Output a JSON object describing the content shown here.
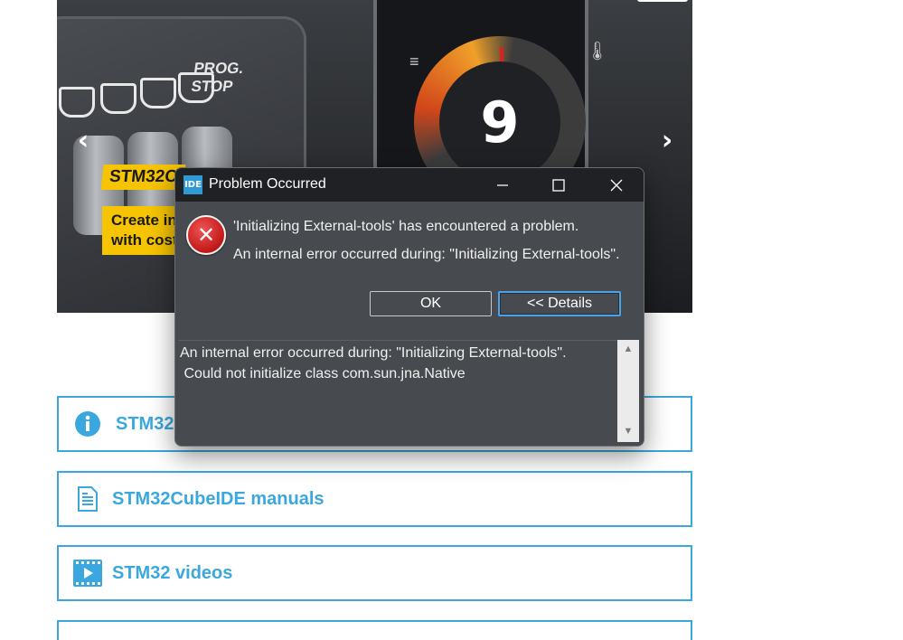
{
  "carousel": {
    "tag_text": "STM32C",
    "tag_text2": "Create in\nwith cost",
    "panel_label": "PROG.\nSTOP",
    "gauge_value": "9",
    "prev_arrow": "‹",
    "next_arrow": "›"
  },
  "cards": [
    {
      "label": "STM32",
      "icon": "info-icon"
    },
    {
      "label": "STM32CubeIDE manuals",
      "icon": "document-icon"
    },
    {
      "label": "STM32 videos",
      "icon": "video-icon"
    }
  ],
  "dialog": {
    "title": "Problem Occurred",
    "app_icon_text": "IDE",
    "message_line1": "'Initializing External-tools' has encountered a problem.",
    "message_line2": "An internal error occurred during: \"Initializing External-tools\".",
    "ok_label": "OK",
    "details_label": "<< Details",
    "details_line1": "An internal error occurred during: \"Initializing External-tools\".",
    "details_line2": " Could not initialize class com.sun.jna.Native"
  },
  "colors": {
    "link_accent": "#3aa8de",
    "dialog_bg": "#474b4f",
    "titlebar_bg": "#202124",
    "error_red": "#c01818"
  }
}
